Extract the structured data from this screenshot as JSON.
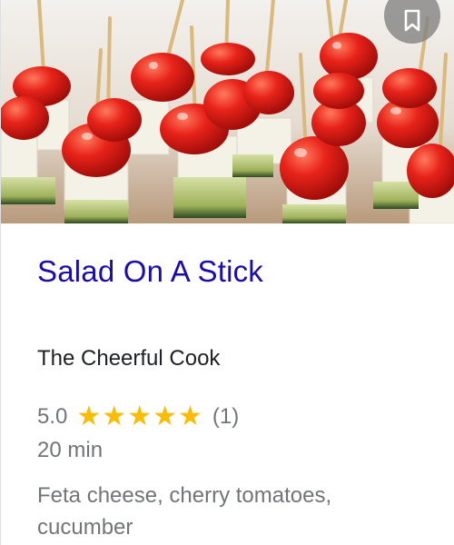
{
  "recipe": {
    "title": "Salad On A Stick",
    "source": "The Cheerful Cook",
    "rating": "5.0",
    "rating_value": 5,
    "stars_max": 5,
    "review_count": "(1)",
    "time": "20 min",
    "ingredients": "Feta cheese, cherry tomatoes, cucumber"
  },
  "icons": {
    "bookmark": "bookmark-icon",
    "star": "star-icon"
  },
  "colors": {
    "title_link": "#1a0dab",
    "star": "#fbbc04",
    "meta_text": "#70757a",
    "source_text": "#202124",
    "bookmark_bg": "#808080"
  }
}
